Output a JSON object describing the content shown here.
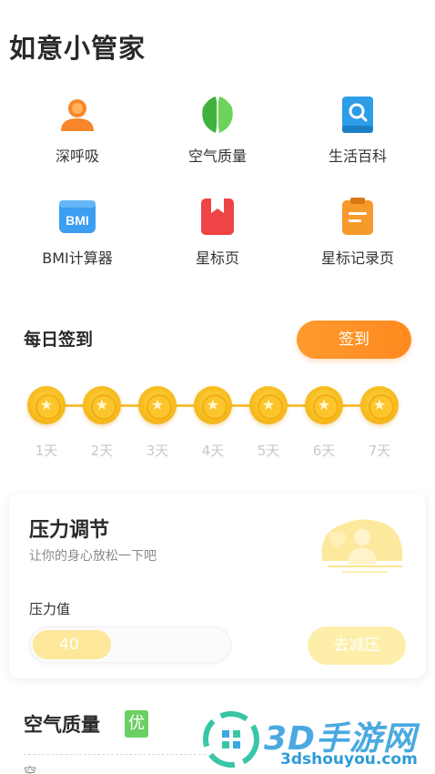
{
  "app": {
    "title": "如意小管家"
  },
  "tools": [
    {
      "label": "深呼吸",
      "icon": "person-icon",
      "color": "#f7862a"
    },
    {
      "label": "空气质量",
      "icon": "leaf-icon",
      "color": "#4cbf4a"
    },
    {
      "label": "生活百科",
      "icon": "book-search-icon",
      "color": "#2e9de8"
    },
    {
      "label": "BMI计算器",
      "icon": "bmi-icon",
      "icon_text": "BMI",
      "color": "#3c9ef0"
    },
    {
      "label": "星标页",
      "icon": "bookmark-icon",
      "color": "#ef4446"
    },
    {
      "label": "星标记录页",
      "icon": "clipboard-icon",
      "color": "#f79a2c"
    }
  ],
  "checkin": {
    "title": "每日签到",
    "button_label": "签到",
    "star_glyph": "★",
    "days": [
      "1天",
      "2天",
      "3天",
      "4天",
      "5天",
      "6天",
      "7天"
    ]
  },
  "stress": {
    "title": "压力调节",
    "subtitle": "让你的身心放松一下吧",
    "value_label": "压力值",
    "value": "40",
    "value_fraction": 0.4,
    "button_label": "去减压"
  },
  "air": {
    "title": "空气质量",
    "badge": "优",
    "badge_color": "#6ccf63",
    "desc": "空"
  },
  "watermark": {
    "brand": "3D手游网",
    "url": "3dshouyou.com"
  }
}
